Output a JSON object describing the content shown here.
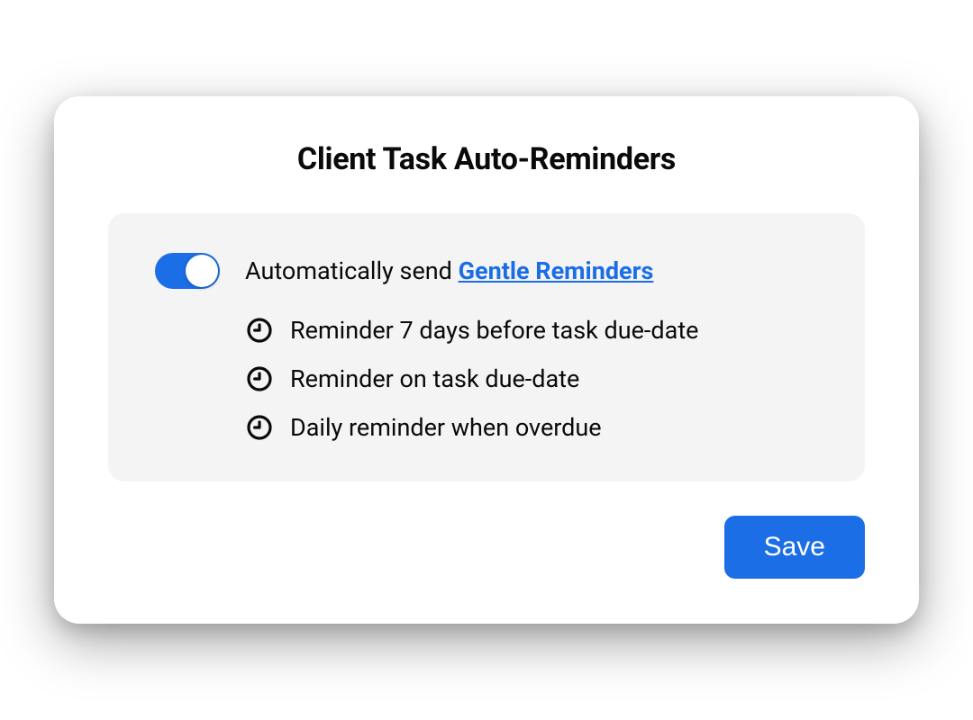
{
  "card": {
    "title": "Client Task Auto-Reminders"
  },
  "toggle": {
    "enabled": true,
    "label_prefix": "Automatically send ",
    "link_text": "Gentle Reminders"
  },
  "reminders": [
    "Reminder 7 days before task due-date",
    "Reminder on task due-date",
    "Daily reminder when overdue"
  ],
  "actions": {
    "save_label": "Save"
  },
  "colors": {
    "accent": "#1b6ee6",
    "panel_bg": "#f4f4f4"
  }
}
